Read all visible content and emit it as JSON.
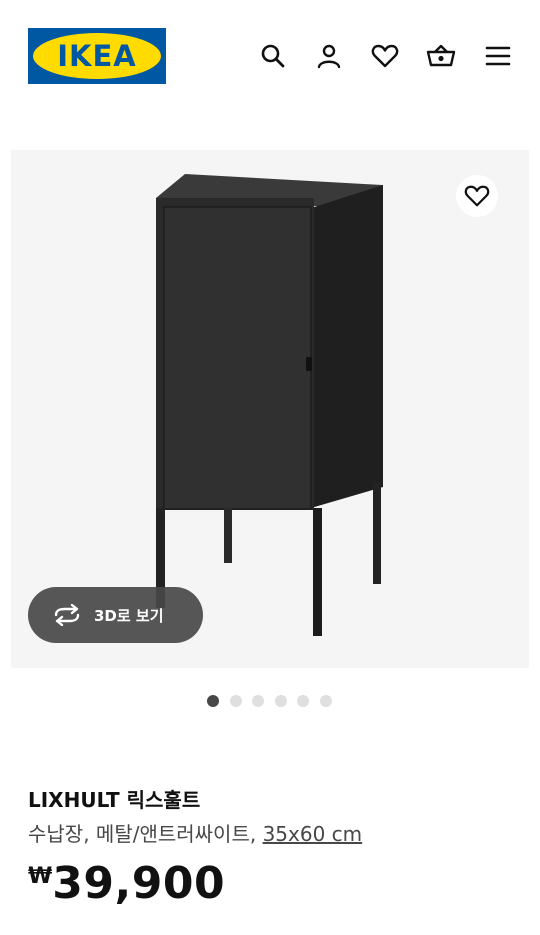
{
  "header": {
    "logo_text": "IKEA",
    "icons": [
      "search-icon",
      "user-icon",
      "heart-icon",
      "cart-icon",
      "menu-icon"
    ]
  },
  "gallery": {
    "button_3d_label": "3D로 보기",
    "dots_total": 6,
    "dots_active_index": 0
  },
  "product": {
    "name": "LIXHULT 릭스훌트",
    "description": "수납장, 메탈/앤트러싸이트, ",
    "size": "35x60 cm",
    "currency": "₩",
    "price": "39,900"
  },
  "colors": {
    "brand_blue": "#0058a3",
    "brand_yellow": "#ffdb00",
    "text": "#111111",
    "cabinet": "#2b2b2b"
  }
}
